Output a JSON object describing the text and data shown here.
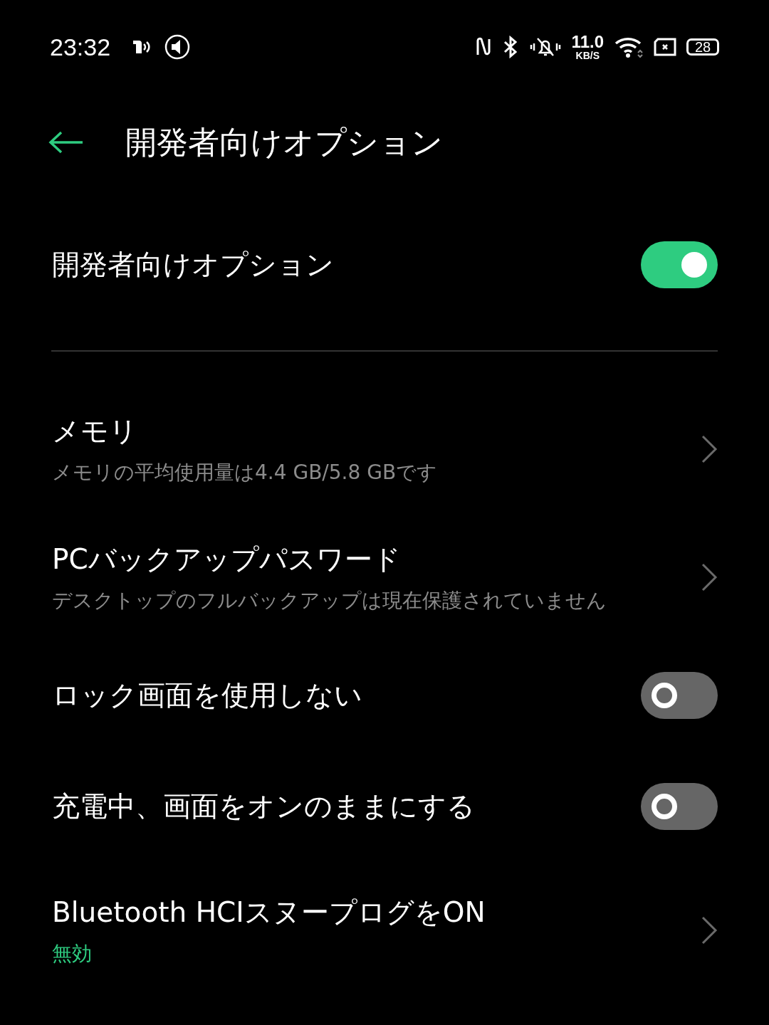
{
  "status_bar": {
    "time": "23:32",
    "speed_value": "11.0",
    "speed_unit": "KB/S",
    "battery": "28"
  },
  "header": {
    "title": "開発者向けオプション"
  },
  "master": {
    "label": "開発者向けオプション",
    "on": true
  },
  "items": [
    {
      "kind": "link",
      "title": "メモリ",
      "subtitle": "メモリの平均使用量は4.4 GB/5.8 GBです",
      "accent": false
    },
    {
      "kind": "link",
      "title": "PCバックアップパスワード",
      "subtitle": "デスクトップのフルバックアップは現在保護されていません",
      "accent": false
    },
    {
      "kind": "toggle",
      "title": "ロック画面を使用しない",
      "on": false
    },
    {
      "kind": "toggle",
      "title": "充電中、画面をオンのままにする",
      "on": false
    },
    {
      "kind": "link",
      "title": "Bluetooth HCIスヌープログをON",
      "subtitle": "無効",
      "accent": true
    }
  ]
}
